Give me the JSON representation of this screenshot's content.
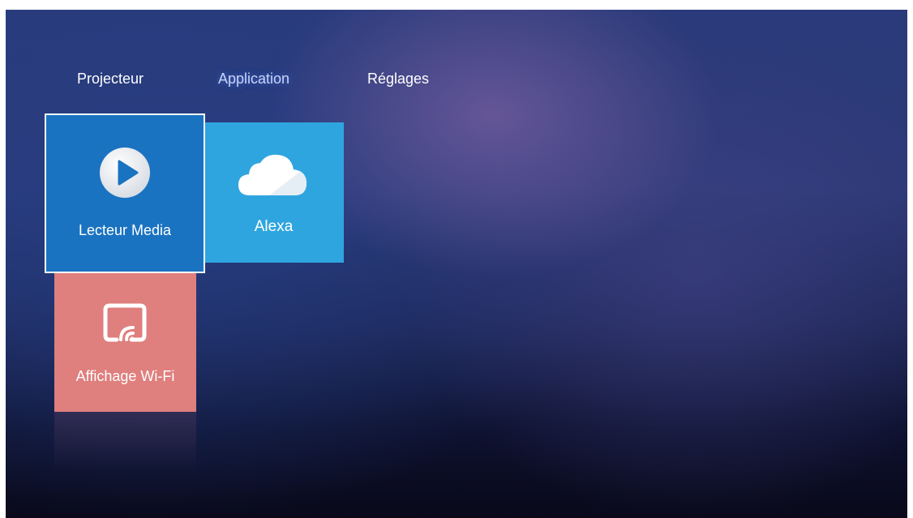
{
  "nav": {
    "tabs": [
      {
        "label": "Projecteur",
        "selected": false
      },
      {
        "label": "Application",
        "selected": true
      },
      {
        "label": "Réglages",
        "selected": false
      }
    ]
  },
  "apps": [
    {
      "label": "Lecteur Media",
      "icon": "play-icon",
      "color": "#1a73c1",
      "focused": true
    },
    {
      "label": "Alexa",
      "icon": "cloud-icon",
      "color": "#2fa5df",
      "focused": false
    },
    {
      "label": "Affichage Wi-Fi",
      "icon": "cast-icon",
      "color": "#df7f7e",
      "focused": false
    }
  ],
  "colors": {
    "focus_border": "#ffffff",
    "selected_tab_glow": "#285adc"
  }
}
